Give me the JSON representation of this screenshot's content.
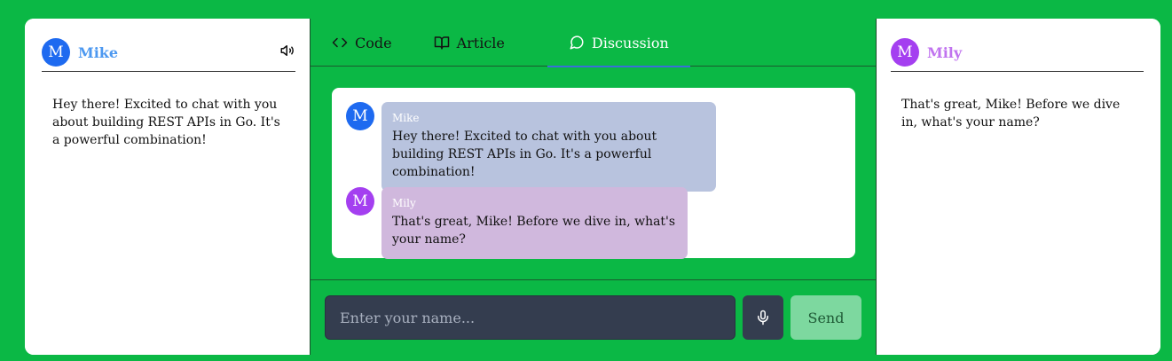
{
  "left_panel": {
    "avatar_letter": "M",
    "name": "Mike",
    "message": "Hey there! Excited to chat with you about building REST APIs in Go. It's a powerful combination!",
    "speaker_icon": "speaker-icon"
  },
  "right_panel": {
    "avatar_letter": "M",
    "name": "Mily",
    "message": "That's great, Mike! Before we dive in, what's your name?"
  },
  "tabs": [
    {
      "label": "Code",
      "icon": "code-icon"
    },
    {
      "label": "Article",
      "icon": "book-icon"
    },
    {
      "label": "Discussion",
      "icon": "chat-bubble-icon",
      "active": true
    }
  ],
  "chat": [
    {
      "avatar_letter": "M",
      "name": "Mike",
      "text": "Hey there! Excited to chat with you about building REST APIs in Go. It's a powerful combination!"
    },
    {
      "avatar_letter": "M",
      "name": "Mily",
      "text": "That's great, Mike! Before we dive in, what's your name?"
    }
  ],
  "input": {
    "placeholder": "Enter your name...",
    "value": "",
    "mic_icon": "microphone-icon",
    "send_label": "Send"
  },
  "colors": {
    "background": "#0bb845",
    "mike_avatar": "#1e6af0",
    "mily_avatar": "#a43ff0",
    "mike_name": "#4c98f0",
    "mily_name": "#c073ef",
    "mike_bubble": "#b8c3de",
    "mily_bubble": "#d0b8dd",
    "input_bg": "#343d4f",
    "send_button": "#7dd89f"
  }
}
